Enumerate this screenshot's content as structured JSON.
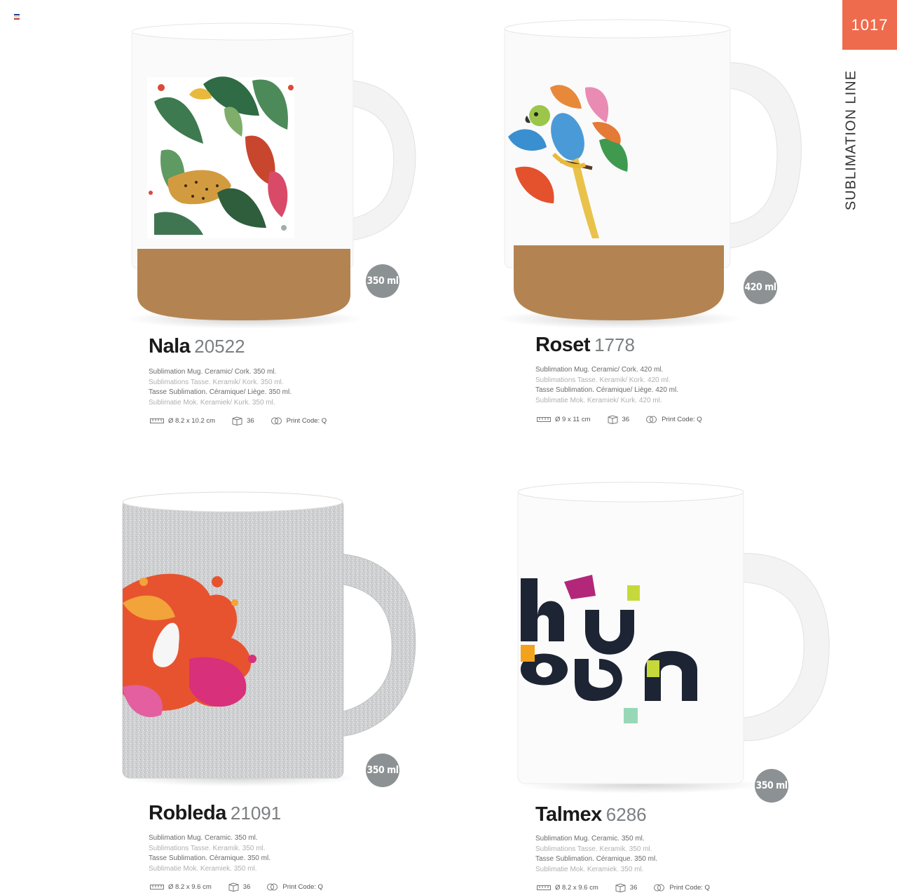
{
  "page": {
    "number": "1017",
    "section": "SUBLIMATION LINE",
    "accent_color": "#ee6b4d",
    "badge_color": "#8c9193"
  },
  "products": [
    {
      "name": "Nala",
      "code": "20522",
      "capacity": "350 ml",
      "desc": [
        "Sublimation Mug. Ceramic/ Cork. 350 ml.",
        "Sublimations Tasse. Keramik/ Kork. 350 ml.",
        "Tasse Sublimation. Céramique/ Liège. 350 ml.",
        "Sublimatie Mok. Keramiek/ Kurk. 350 ml."
      ],
      "dimensions": "Ø 8.2 x 10.2 cm",
      "box_qty": "36",
      "print_code": "Print Code: Q"
    },
    {
      "name": "Roset",
      "code": "1778",
      "capacity": "420 ml",
      "desc": [
        "Sublimation Mug. Ceramic/ Cork. 420 ml.",
        "Sublimations Tasse. Keramik/ Kork. 420 ml.",
        "Tasse Sublimation. Céramique/ Liège. 420 ml.",
        "Sublimatie Mok. Keramiek/ Kurk. 420 ml."
      ],
      "dimensions": "Ø 9 x 11 cm",
      "box_qty": "36",
      "print_code": "Print Code: Q"
    },
    {
      "name": "Robleda",
      "code": "21091",
      "capacity": "350 ml",
      "desc": [
        "Sublimation Mug. Ceramic. 350 ml.",
        "Sublimations Tasse. Keramik. 350 ml.",
        "Tasse Sublimation. Céramique. 350 ml.",
        "Sublimatie Mok. Keramiek. 350 ml."
      ],
      "dimensions": "Ø 8.2 x 9.6 cm",
      "box_qty": "36",
      "print_code": "Print Code: Q"
    },
    {
      "name": "Talmex",
      "code": "6286",
      "capacity": "350 ml",
      "desc": [
        "Sublimation Mug. Ceramic. 350 ml.",
        "Sublimations Tasse. Keramik. 350 ml.",
        "Tasse Sublimation. Céramique. 350 ml.",
        "Sublimatie Mok. Keramiek. 350 ml."
      ],
      "dimensions": "Ø 8.2 x 9.6 cm",
      "box_qty": "36",
      "print_code": "Print Code: Q"
    }
  ]
}
